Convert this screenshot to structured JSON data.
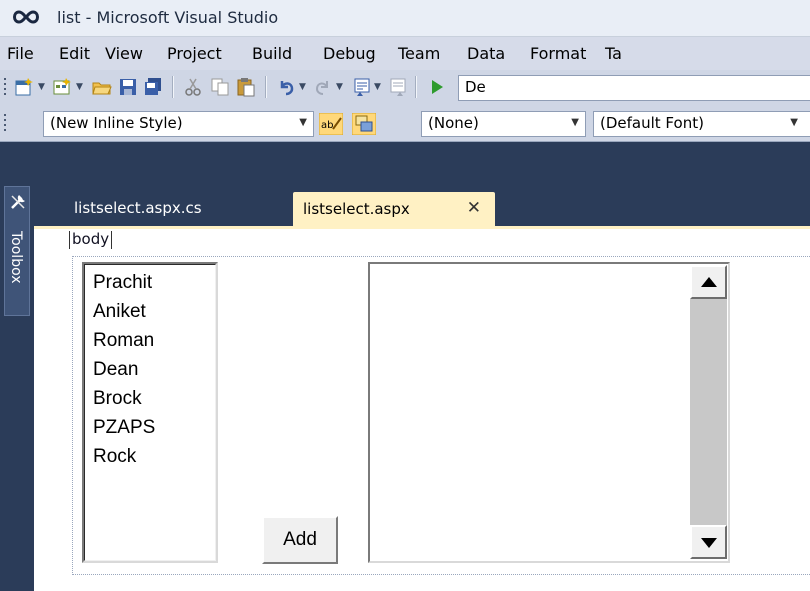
{
  "window": {
    "title": "list - Microsoft Visual Studio"
  },
  "menu": [
    "File",
    "Edit",
    "View",
    "Project",
    "Build",
    "Debug",
    "Team",
    "Data",
    "Format",
    "Ta"
  ],
  "toolbar1": {
    "config_label": "De"
  },
  "toolbar2": {
    "style_combo": "(New Inline Style)",
    "target_combo": "(None)",
    "font_combo": "(Default Font)"
  },
  "toolbox": {
    "label": "Toolbox"
  },
  "tabs": [
    {
      "label": "listselect.aspx.cs",
      "active": false
    },
    {
      "label": "listselect.aspx",
      "active": true,
      "close": "✕"
    }
  ],
  "designer": {
    "breadcrumb": "body",
    "listbox_left": [
      "Prachit",
      "Aniket",
      "Roman",
      "Dean",
      "Brock",
      "PZAPS",
      "Rock"
    ],
    "add_button": "Add",
    "listbox_right": []
  },
  "colors": {
    "ide_background": "#2b3c59",
    "active_tab": "#fff1c4",
    "toolbar": "#cfd6e5"
  }
}
